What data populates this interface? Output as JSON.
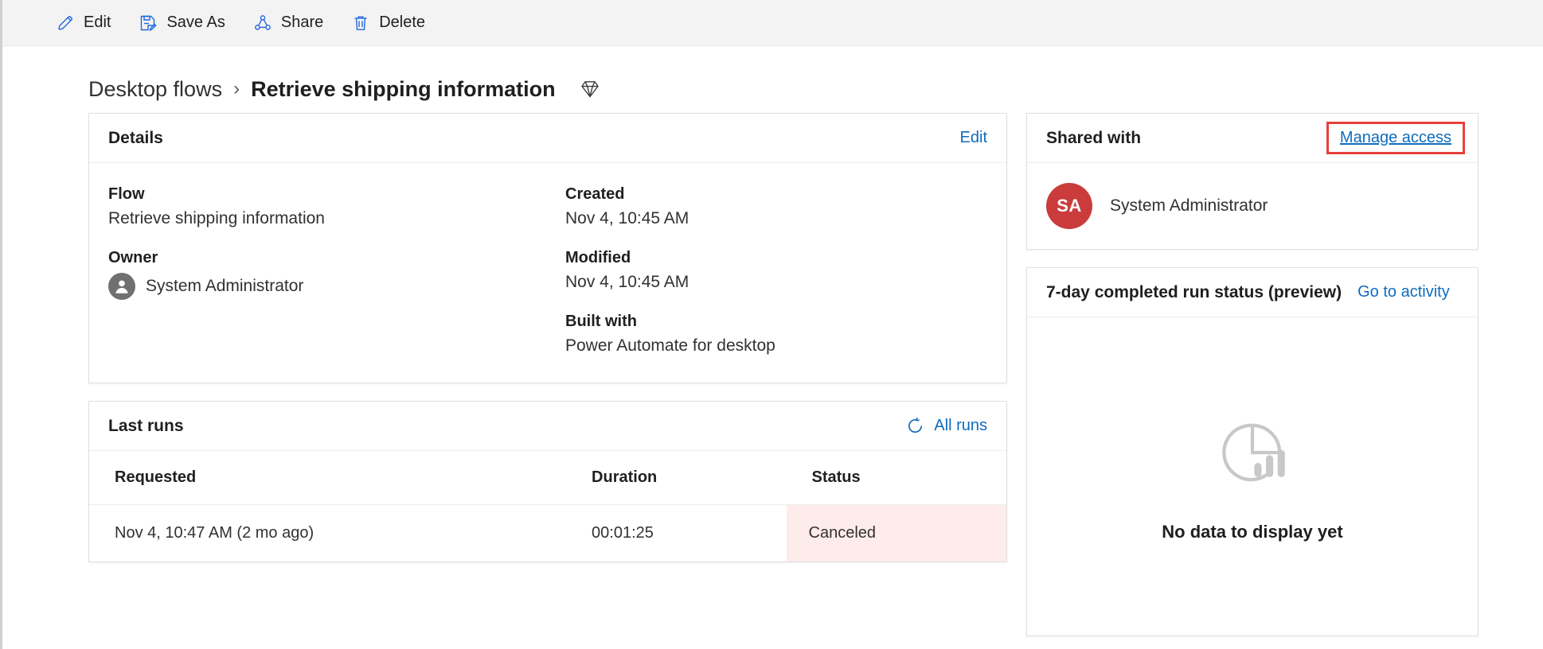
{
  "commandbar": {
    "buttons": [
      {
        "label": "Edit",
        "icon": "pencil-icon"
      },
      {
        "label": "Save As",
        "icon": "save-as-icon"
      },
      {
        "label": "Share",
        "icon": "share-icon"
      },
      {
        "label": "Delete",
        "icon": "trash-icon"
      }
    ]
  },
  "breadcrumb": {
    "parent": "Desktop flows",
    "separator": "›",
    "current": "Retrieve shipping information",
    "premium_icon": "diamond-icon"
  },
  "details": {
    "title": "Details",
    "edit_label": "Edit",
    "fields": {
      "flow_label": "Flow",
      "flow_value": "Retrieve shipping information",
      "owner_label": "Owner",
      "owner_value": "System Administrator",
      "created_label": "Created",
      "created_value": "Nov 4, 10:45 AM",
      "modified_label": "Modified",
      "modified_value": "Nov 4, 10:45 AM",
      "built_with_label": "Built with",
      "built_with_value": "Power Automate for desktop"
    }
  },
  "last_runs": {
    "title": "Last runs",
    "all_runs_label": "All runs",
    "refresh_icon": "refresh-icon",
    "columns": [
      "Requested",
      "Duration",
      "Status"
    ],
    "rows": [
      {
        "requested": "Nov 4, 10:47 AM (2 mo ago)",
        "duration": "00:01:25",
        "status": "Canceled"
      }
    ]
  },
  "shared_with": {
    "title": "Shared with",
    "manage_access_label": "Manage access",
    "highlight_color": "#e8403a",
    "people": [
      {
        "initials": "SA",
        "name": "System Administrator",
        "avatar_color": "#ca3c3c"
      }
    ]
  },
  "run_status": {
    "title": "7-day completed run status (preview)",
    "activity_link_label": "Go to activity",
    "empty_icon": "pie-chart-bars-icon",
    "empty_text": "No data to display yet"
  },
  "colors": {
    "accent": "#0f6cbd",
    "command_bar_bg": "#f3f3f3",
    "status_canceled_bg": "#fdecea",
    "text_primary": "#201f1e"
  }
}
